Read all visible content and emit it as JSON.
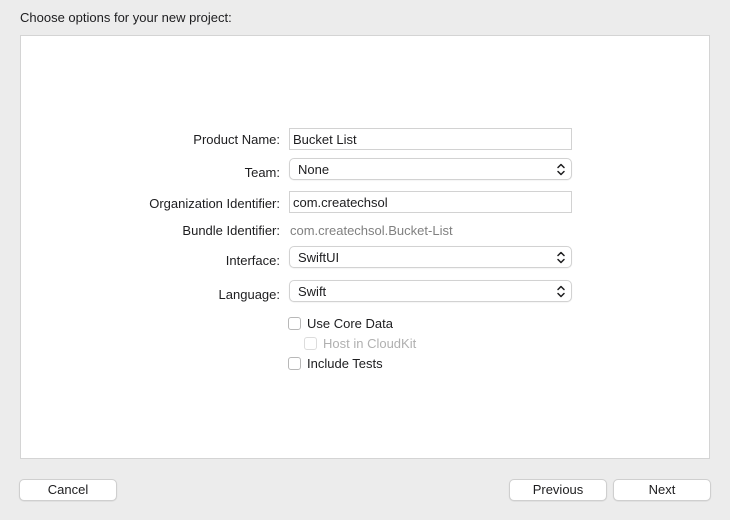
{
  "dialog": {
    "title": "Choose options for your new project:"
  },
  "form": {
    "product_name": {
      "label": "Product Name:",
      "value": "Bucket List"
    },
    "team": {
      "label": "Team:",
      "value": "None"
    },
    "organization_identifier": {
      "label": "Organization Identifier:",
      "value": "com.createchsol"
    },
    "bundle_identifier": {
      "label": "Bundle Identifier:",
      "value": "com.createchsol.Bucket-List"
    },
    "interface": {
      "label": "Interface:",
      "value": "SwiftUI"
    },
    "language": {
      "label": "Language:",
      "value": "Swift"
    },
    "use_core_data": {
      "label": "Use Core Data",
      "checked": false
    },
    "host_in_cloudkit": {
      "label": "Host in CloudKit",
      "checked": false,
      "enabled": false
    },
    "include_tests": {
      "label": "Include Tests",
      "checked": false
    }
  },
  "buttons": {
    "cancel": "Cancel",
    "previous": "Previous",
    "next": "Next"
  }
}
